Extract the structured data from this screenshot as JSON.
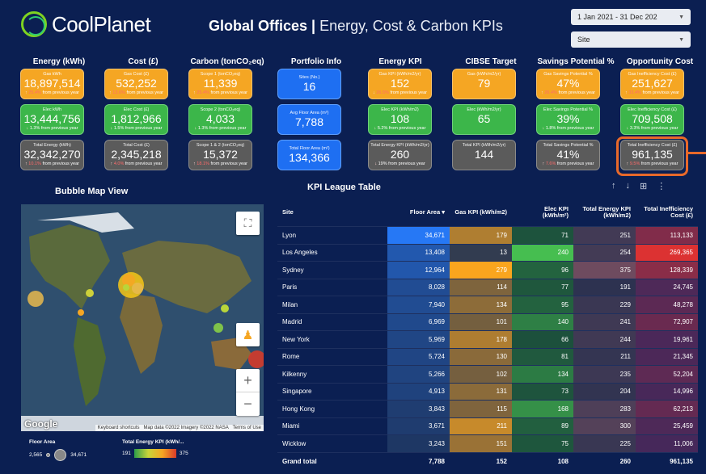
{
  "brand": {
    "name": "CoolPlanet"
  },
  "header": {
    "title_bold": "Global Offices |",
    "title_light": " Energy, Cost & Carbon KPIs"
  },
  "filters": {
    "date_range": "1 Jan 2021 - 31 Dec 202",
    "site": "Site"
  },
  "columns": [
    {
      "title": "Energy (kWh)"
    },
    {
      "title": "Cost (£)"
    },
    {
      "title": "Carbon (tonCO₂eq)"
    },
    {
      "title": "Portfolio Info"
    },
    {
      "title": "Energy KPI"
    },
    {
      "title": "CIBSE Target"
    },
    {
      "title": "Savings Potential %"
    },
    {
      "title": "Opportunity Cost"
    }
  ],
  "cards": {
    "gas_kwh": {
      "label": "Gas kWh",
      "value": "18,897,514",
      "change": "25.4%",
      "suffix": "from previous year"
    },
    "gas_cost": {
      "label": "Gas Cost (£)",
      "value": "532,252",
      "change": "13.6%",
      "suffix": "from previous year"
    },
    "scope1": {
      "label": "Scope 1 (tonCO₂eq)",
      "value": "11,339",
      "change": "25.4%",
      "suffix": "from previous year"
    },
    "sites": {
      "label": "Sites (No.)",
      "value": "16"
    },
    "gas_kpi": {
      "label": "Gas KPI (kWh/m2/yr)",
      "value": "152",
      "change": "26.5%",
      "suffix": "from previous year"
    },
    "gas_target": {
      "label": "Gas (kWh/m2/yr)",
      "value": "79"
    },
    "gas_savings": {
      "label": "Gas Savings Potential %",
      "value": "47%",
      "change": "26.4%",
      "suffix": "from previous year"
    },
    "gas_ineff": {
      "label": "Gas Inefficiency Cost (£)",
      "value": "251,627",
      "change": "33.4%",
      "suffix": "from previous year"
    },
    "elec_kwh": {
      "label": "Elec kWh",
      "value": "13,444,756",
      "change": "1.3%",
      "suffix": "from previous year"
    },
    "elec_cost": {
      "label": "Elec Cost (£)",
      "value": "1,812,966",
      "change": "1.5%",
      "suffix": "from previous year"
    },
    "scope2": {
      "label": "Scope 2 (tonCO₂eq)",
      "value": "4,033",
      "change": "1.3%",
      "suffix": "from previous year"
    },
    "floor": {
      "label": "Avg Floor Area (m²)",
      "value": "7,788"
    },
    "elec_kpi": {
      "label": "Elec KPI (kWh/m2)",
      "value": "108",
      "change": "5.2%",
      "suffix": "from previous year"
    },
    "elec_target": {
      "label": "Elec (kWh/m2/yr)",
      "value": "65"
    },
    "elec_savings": {
      "label": "Elec Savings Potential %",
      "value": "39%",
      "change": "1.8%",
      "suffix": "from previous year"
    },
    "elec_ineff": {
      "label": "Elec Inefficiency Cost (£)",
      "value": "709,508",
      "change": "3.3%",
      "suffix": "from previous year"
    },
    "total_energy": {
      "label": "Total Energy (kWh)",
      "value": "32,342,270",
      "change": "10.1%",
      "suffix": "from previous year"
    },
    "total_cost": {
      "label": "Total Cost (£)",
      "value": "2,345,218",
      "change": "4.0%",
      "suffix": "from previous year"
    },
    "scope12": {
      "label": "Scope 1 & 2 (tonCO₂eq)",
      "value": "15,372",
      "change": "18.1%",
      "suffix": "from previous year"
    },
    "total_floor": {
      "label": "Total Floor Area (m²)",
      "value": "134,366"
    },
    "total_kpi": {
      "label": "Total Energy KPI (kWh/m2/yr)",
      "value": "260",
      "change": "19%",
      "suffix": "from previous year"
    },
    "total_target": {
      "label": "Total KPI (kWh/m2/yr)",
      "value": "144"
    },
    "total_savings": {
      "label": "Total Savings Potential %",
      "value": "41%",
      "change": "7.6%",
      "suffix": "from previous year"
    },
    "total_ineff": {
      "label": "Total Inefficiency Cost (£)",
      "value": "961,135",
      "change": "9.5%",
      "suffix": "from previous year"
    }
  },
  "map": {
    "title": "Bubble Map View",
    "google": "Google",
    "attribution": [
      "Keyboard shortcuts",
      "Map data ©2022 Imagery ©2022 NASA",
      "Terms of Use"
    ],
    "legend": {
      "floor_title": "Floor Area",
      "floor_min": "2,565",
      "floor_max": "34,671",
      "kpi_title": "Total Energy KPI (kWh/...",
      "kpi_min": "191",
      "kpi_max": "375"
    }
  },
  "table": {
    "title": "KPI League Table",
    "headers": [
      "Site",
      "Floor Area",
      "Gas KPI (kWh/m2)",
      "Elec KPI (kWh/m²)",
      "Total Energy KPI (kWh/m2)",
      "Total Inefficiency Cost (£)"
    ],
    "sort_indicator": "▾",
    "rows": [
      [
        "Lyon",
        "34,671",
        "179",
        "71",
        "251",
        "113,133"
      ],
      [
        "Los Angeles",
        "13,408",
        "13",
        "240",
        "254",
        "269,365"
      ],
      [
        "Sydney",
        "12,964",
        "279",
        "96",
        "375",
        "128,339"
      ],
      [
        "Paris",
        "8,028",
        "114",
        "77",
        "191",
        "24,745"
      ],
      [
        "Milan",
        "7,940",
        "134",
        "95",
        "229",
        "48,278"
      ],
      [
        "Madrid",
        "6,969",
        "101",
        "140",
        "241",
        "72,907"
      ],
      [
        "New York",
        "5,969",
        "178",
        "66",
        "244",
        "19,961"
      ],
      [
        "Rome",
        "5,724",
        "130",
        "81",
        "211",
        "21,345"
      ],
      [
        "Kilkenny",
        "5,266",
        "102",
        "134",
        "235",
        "52,204"
      ],
      [
        "Singapore",
        "4,913",
        "131",
        "73",
        "204",
        "14,996"
      ],
      [
        "Hong Kong",
        "3,843",
        "115",
        "168",
        "283",
        "62,213"
      ],
      [
        "Miami",
        "3,671",
        "211",
        "89",
        "300",
        "25,459"
      ],
      [
        "Wicklow",
        "3,243",
        "151",
        "75",
        "225",
        "11,006"
      ]
    ],
    "total": [
      "Grand total",
      "7,788",
      "152",
      "108",
      "260",
      "961,135"
    ]
  },
  "colors": {
    "bg": "#0b1f52",
    "orange": "#f5a623",
    "green": "#3cb64a",
    "grey": "#5b5b5b",
    "blue": "#1e6ff2",
    "highlight": "#e8692a"
  }
}
